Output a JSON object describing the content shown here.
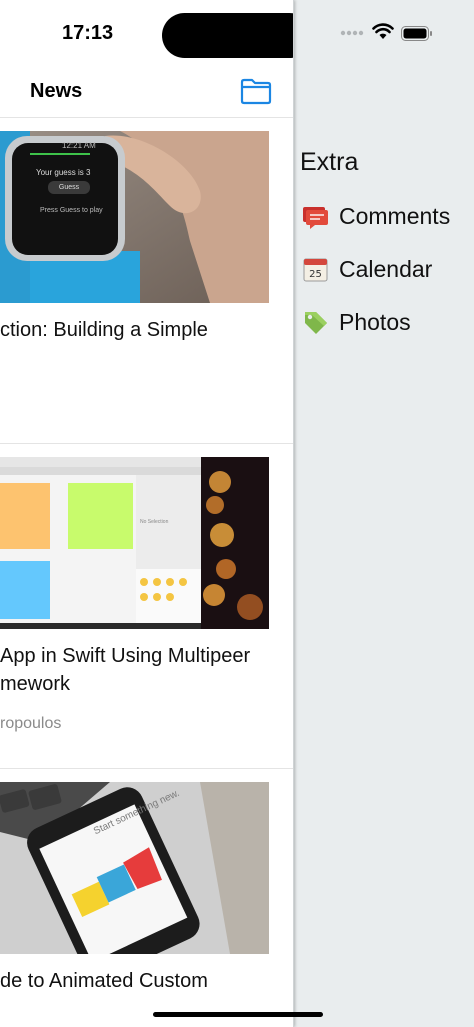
{
  "status_bar": {
    "time": "17:13"
  },
  "nav": {
    "title": "News"
  },
  "side_menu": {
    "title": "Extra",
    "items": [
      {
        "label": "Comments",
        "icon": "comments-icon"
      },
      {
        "label": "Calendar",
        "icon": "calendar-icon",
        "icon_text": "25"
      },
      {
        "label": "Photos",
        "icon": "tag-icon"
      }
    ]
  },
  "articles": [
    {
      "title": "ction: Building a Simple",
      "image": {
        "watch_time": "12:21 AM",
        "watch_text": "Your guess is 3",
        "watch_button": "Guess",
        "watch_footer": "Press Guess to play"
      }
    },
    {
      "title_line1": "App in Swift Using Multipeer",
      "title_line2": "mework",
      "author": "ropoulos",
      "image": {
        "screen_text": "No Selection"
      }
    },
    {
      "title": "de to Animated Custom",
      "image": {
        "screen_text": "Start something new."
      }
    }
  ],
  "colors": {
    "accent": "#1b86e3",
    "menu_bg": "#e9edee"
  }
}
